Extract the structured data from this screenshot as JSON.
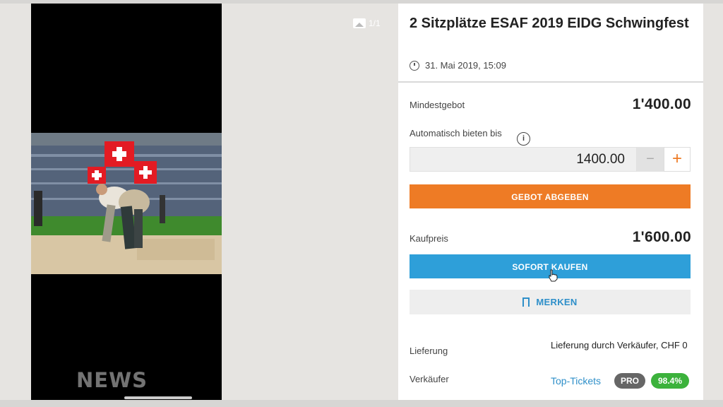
{
  "gallery": {
    "counter": "1/1",
    "watermark": "NEWS"
  },
  "listing": {
    "title": "2 Sitzplätze ESAF 2019 EIDG Schwingfest",
    "date": "31. Mai 2019, 15:09"
  },
  "bidding": {
    "min_bid_label": "Mindestgebot",
    "min_bid_value": "1'400.00",
    "auto_bid_label": "Automatisch bieten bis",
    "info_icon": "i",
    "auto_bid_value": "1400.00",
    "minus": "−",
    "plus": "+",
    "submit_bid": "GEBOT ABGEBEN"
  },
  "buy_now": {
    "label": "Kaufpreis",
    "value": "1'600.00",
    "button": "SOFORT KAUFEN"
  },
  "watch": {
    "button": "MERKEN"
  },
  "details": {
    "delivery_label": "Lieferung",
    "delivery_value": "Lieferung durch Verkäufer, CHF 0",
    "seller_label": "Verkäufer",
    "seller_name": "Top-Tickets",
    "seller_badge": "PRO",
    "seller_rating": "98.4%"
  },
  "colors": {
    "accent_orange": "#ee7b25",
    "accent_blue": "#2e9fd9",
    "rating_green": "#3cb23c"
  }
}
